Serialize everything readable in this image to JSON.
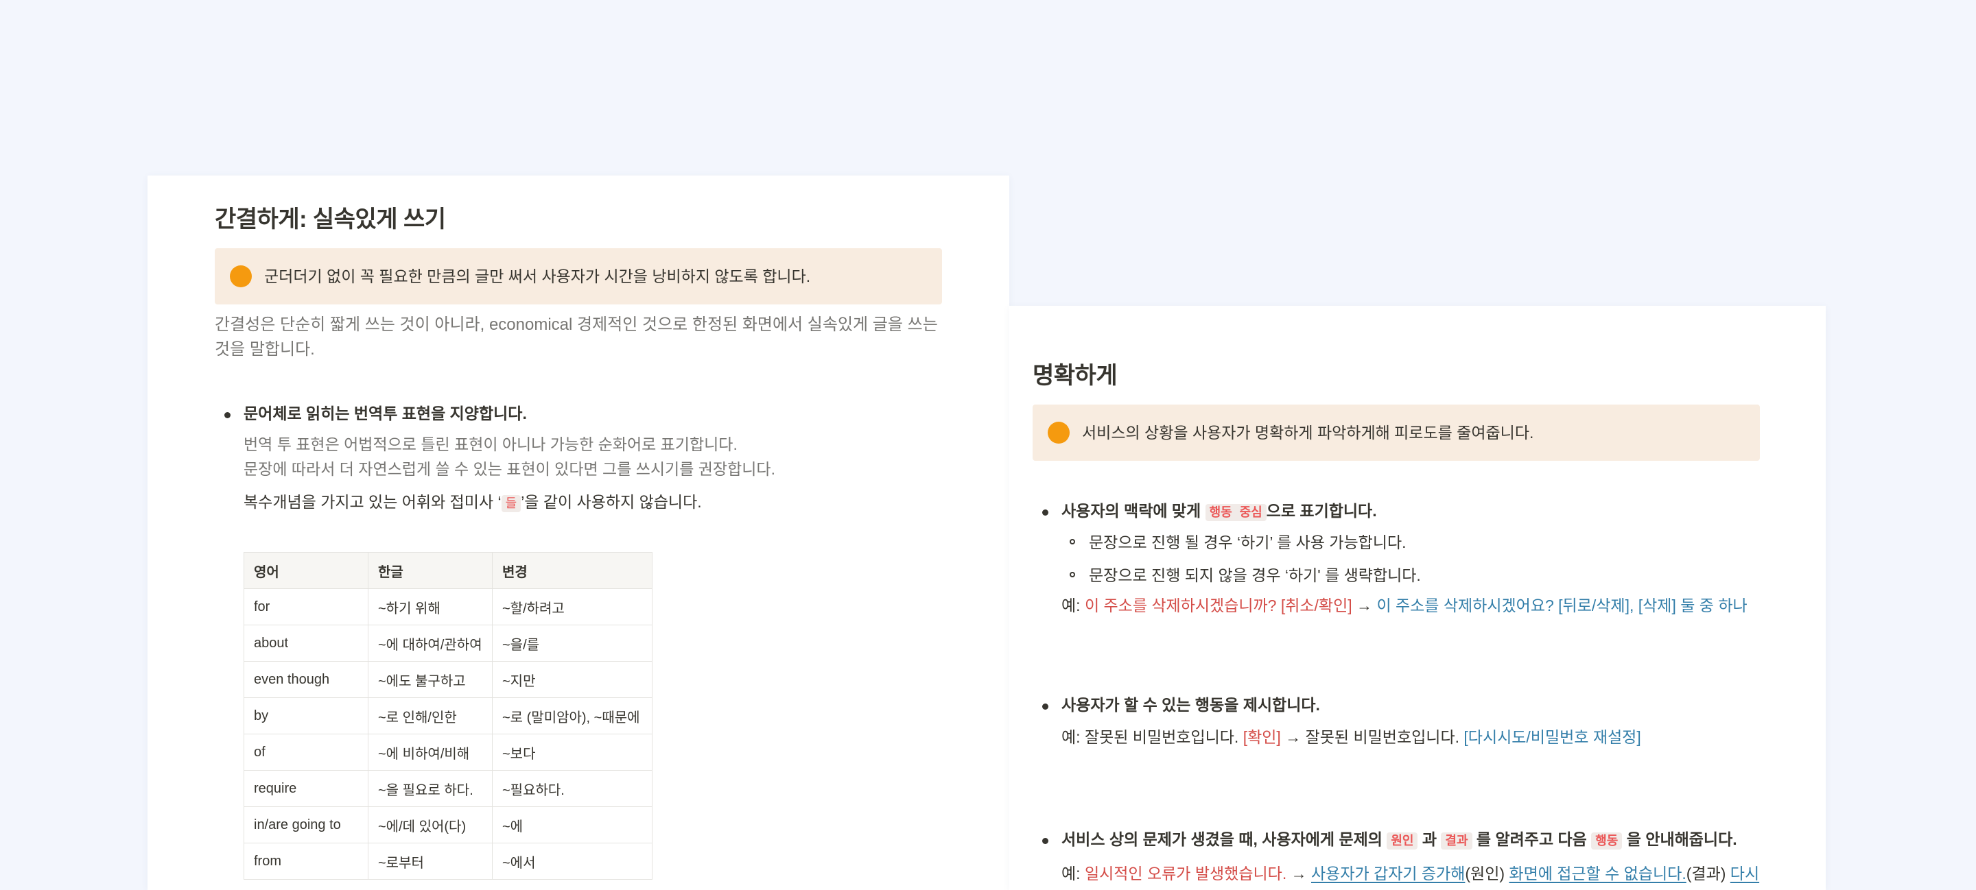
{
  "left": {
    "title": "간결하게: 실속있게 쓰기",
    "callout": "군더더기 없이 꼭 필요한 만큼의 글만 써서 사용자가 시간을 낭비하지 않도록 합니다.",
    "intro": "간결성은 단순히 짧게 쓰는 것이 아니라, economical 경제적인 것으로 한정된 화면에서 실속있게 글을 쓰는 것을 말합니다.",
    "bullet1": {
      "heading": "문어체로 읽히는 번역투 표현을 지양합니다.",
      "desc1": "번역 투 표현은 어법적으로 틀린 표현이 아니나 가능한 순화어로 표기합니다.",
      "desc2": "문장에 따라서 더 자연스럽게 쓸 수 있는 표현이 있다면 그를 쓰시기를 권장합니다.",
      "note_pre": "복수개념을 가지고 있는 어휘와 접미사 ‘",
      "note_code": "들",
      "note_post": "’을 같이 사용하지 않습니다."
    },
    "table": {
      "headers": [
        "영어",
        "한글",
        "변경"
      ],
      "rows": [
        [
          "for",
          "~하기 위해",
          "~할/하려고"
        ],
        [
          "about",
          "~에 대하여/관하여",
          "~을/를"
        ],
        [
          "even though",
          "~에도 불구하고",
          "~지만"
        ],
        [
          "by",
          "~로 인해/인한",
          "~로 (말미암아), ~때문에"
        ],
        [
          "of",
          "~에 비하여/비해",
          "~보다"
        ],
        [
          "require",
          "~을 필요로 하다.",
          "~필요하다."
        ],
        [
          "in/are going to",
          "~에/데 있어(다)",
          "~에"
        ],
        [
          "from",
          "~로부터",
          "~에서"
        ]
      ]
    }
  },
  "right": {
    "title": "명확하게",
    "callout": "서비스의 상황을 사용자가 명확하게 파악하게해 피로도를 줄여줍니다.",
    "b1": {
      "pre": "사용자의 맥락에 맞게 ",
      "code": "행동 중심",
      "post": "으로 표기합니다.",
      "sub1": "문장으로 진행 될 경우 ‘하기’ 를 사용 가능합니다.",
      "sub2": "문장으로 진행 되지 않을 경우 ‘하기' 를 생략합니다.",
      "ex_label": "예: ",
      "ex_bad": "이 주소를 삭제하시겠습니까? [취소/확인]",
      "arrow": " → ",
      "ex_good": "이 주소를 삭제하시겠어요? [뒤로/삭제], [삭제] 둘 중 하나"
    },
    "b2": {
      "heading": "사용자가 할 수 있는 행동을 제시합니다.",
      "ex_pre": "예: 잘못된 비밀번호입니다. ",
      "ex_bad": "[확인]",
      "ex_mid": " → 잘못된 비밀번호입니다. ",
      "ex_good": "[다시시도/비밀번호 재설정]"
    },
    "b3": {
      "pre": "서비스 상의 문제가 생겼을 때, 사용자에게 문제의 ",
      "code1": "원인",
      "mid1": " 과 ",
      "code2": "결과",
      "mid2": " 를 알려주고 다음 ",
      "code3": "행동",
      "post": " 을 안내해줍니다.",
      "ex_label": "예: ",
      "ex_bad": "일시적인 오류가 발생했습니다.",
      "arrow": " → ",
      "ex_cause": "사용자가 갑자기 증가해",
      "cause_label": "(원인) ",
      "ex_result": "화면에 접근할 수 없습니다.",
      "result_label": "(결과) ",
      "ex_action": "다시"
    }
  }
}
